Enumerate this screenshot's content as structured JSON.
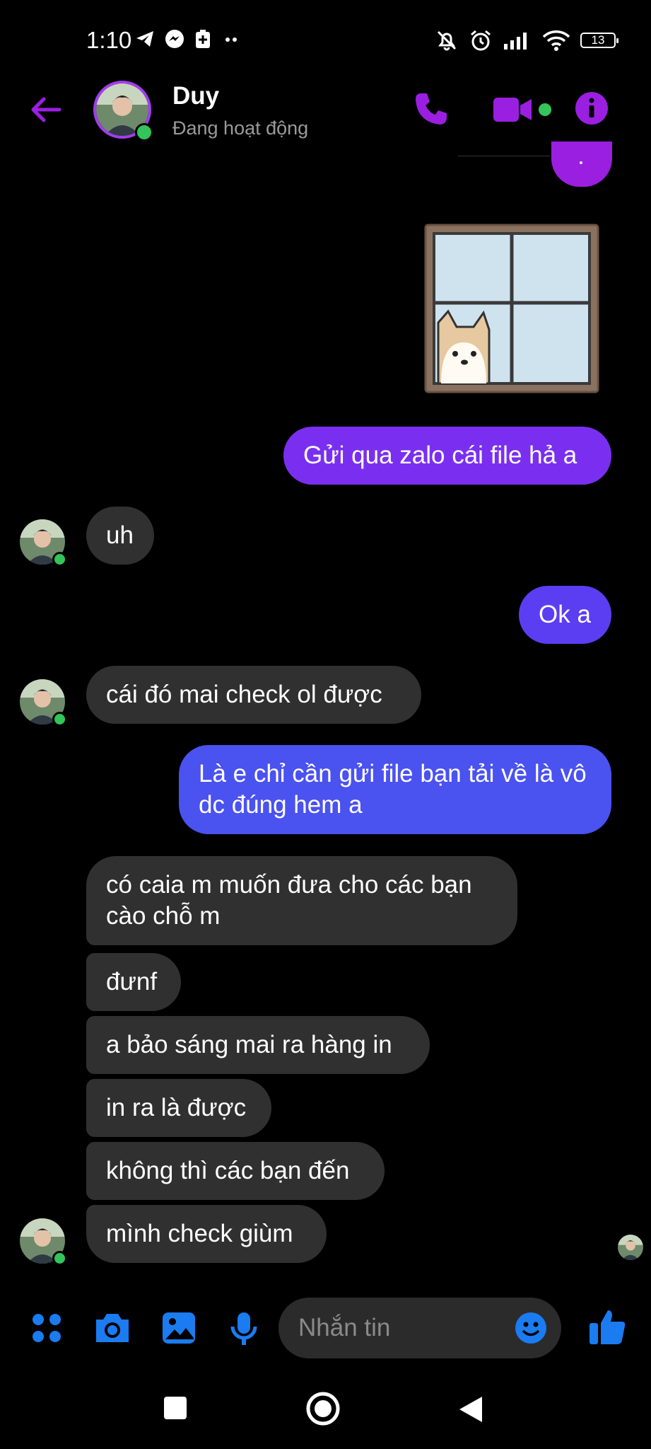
{
  "status_bar": {
    "time": "1:10",
    "battery": "13"
  },
  "header": {
    "contact_name": "Duy",
    "contact_status": "Đang hoạt động"
  },
  "messages": {
    "m1": "Gửi qua zalo cái file hả a",
    "m2": "uh",
    "m3": "Ok a",
    "m4": "cái đó mai check ol được",
    "m5": "Là e chỉ cần gửi file bạn tải về là vô dc đúng hem a",
    "m6": "có caia m muốn đưa cho các bạn cào chỗ m",
    "m7": "đưnf",
    "m8": "a bảo sáng mai ra hàng in",
    "m9": "in ra là được",
    "m10": "không thì các bạn đến",
    "m11": "mình check giùm"
  },
  "composer": {
    "placeholder": "Nhắn tin"
  },
  "colors": {
    "accent_purple": "#9b1fe0",
    "bubble_purple": "#7a2ff0",
    "bubble_blue": "#4a52f0",
    "incoming_bubble": "#303030",
    "composer_blue": "#1a7cf0",
    "online_green": "#33c45a"
  }
}
